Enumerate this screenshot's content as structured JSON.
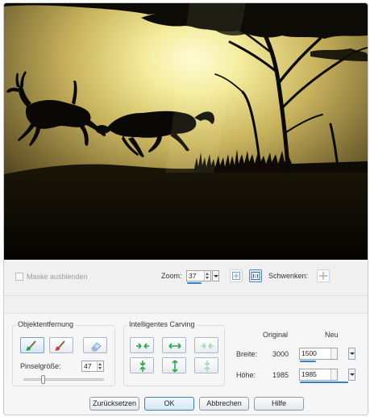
{
  "toolbar": {
    "mask_label": "Maske ausblenden",
    "zoom_label": "Zoom:",
    "zoom_value": "37",
    "pan_label": "Schwenken:"
  },
  "object_removal": {
    "title": "Objektentfernung",
    "brush_size_label": "Pinselgröße:",
    "brush_size_value": "47"
  },
  "carving": {
    "title": "Intelligentes Carving"
  },
  "dimensions": {
    "col_original": "Original",
    "col_new": "Neu",
    "width_label": "Breite:",
    "width_original": "3000",
    "width_new": "1500",
    "height_label": "Höhe:",
    "height_original": "1985",
    "height_new": "1985"
  },
  "buttons": {
    "reset": "Zurücksetzen",
    "ok": "OK",
    "cancel": "Abbrechen",
    "help": "Hilfe"
  },
  "icons": {
    "mask_brush_green": "brush-green-icon",
    "mask_brush_red": "brush-red-icon",
    "eraser": "eraser-icon",
    "fit": "fit-to-window-icon",
    "actual": "actual-size-icon",
    "pan": "pan-icon",
    "accent": "#2f7fd6",
    "arrow_green": "#2aa84a"
  }
}
